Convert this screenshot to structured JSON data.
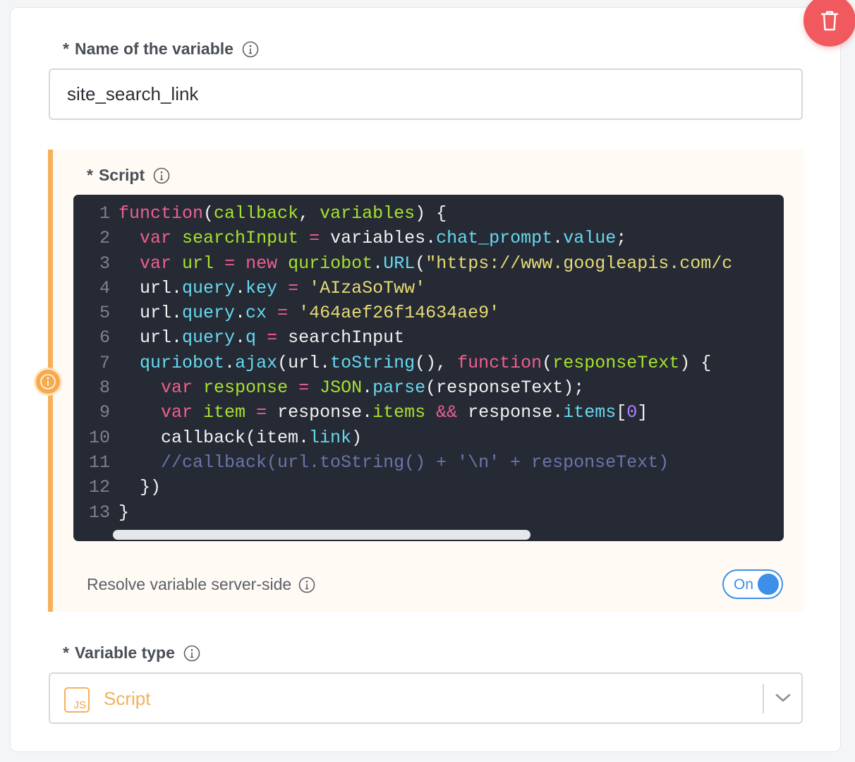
{
  "variable_name": {
    "required_marker": "*",
    "label": "Name of the variable",
    "value": "site_search_link"
  },
  "script": {
    "required_marker": "*",
    "label": "Script",
    "lines": [
      {
        "number": "1",
        "tokens": [
          [
            "kw",
            "function"
          ],
          [
            "p",
            "("
          ],
          [
            "fn",
            "callback"
          ],
          [
            "p",
            ", "
          ],
          [
            "fn",
            "variables"
          ],
          [
            "p",
            ") {"
          ]
        ]
      },
      {
        "number": "2",
        "tokens": [
          [
            "p",
            "  "
          ],
          [
            "kw",
            "var"
          ],
          [
            "p",
            " "
          ],
          [
            "fn",
            "searchInput"
          ],
          [
            "p",
            " "
          ],
          [
            "kw",
            "="
          ],
          [
            "p",
            " variables."
          ],
          [
            "prop",
            "chat_prompt"
          ],
          [
            "p",
            "."
          ],
          [
            "prop",
            "value"
          ],
          [
            "p",
            ";"
          ]
        ]
      },
      {
        "number": "3",
        "tokens": [
          [
            "p",
            "  "
          ],
          [
            "kw",
            "var"
          ],
          [
            "p",
            " "
          ],
          [
            "fn",
            "url"
          ],
          [
            "p",
            " "
          ],
          [
            "kw",
            "="
          ],
          [
            "p",
            " "
          ],
          [
            "kw",
            "new"
          ],
          [
            "p",
            " "
          ],
          [
            "fn",
            "quriobot"
          ],
          [
            "p",
            "."
          ],
          [
            "prop",
            "URL"
          ],
          [
            "p",
            "("
          ],
          [
            "str",
            "\"https://www.googleapis.com/c"
          ]
        ]
      },
      {
        "number": "4",
        "tokens": [
          [
            "p",
            "  url."
          ],
          [
            "prop",
            "query"
          ],
          [
            "p",
            "."
          ],
          [
            "prop",
            "key"
          ],
          [
            "p",
            " "
          ],
          [
            "kw",
            "="
          ],
          [
            "p",
            " "
          ],
          [
            "str",
            "'AIzaSoTww'"
          ]
        ]
      },
      {
        "number": "5",
        "tokens": [
          [
            "p",
            "  url."
          ],
          [
            "prop",
            "query"
          ],
          [
            "p",
            "."
          ],
          [
            "prop",
            "cx"
          ],
          [
            "p",
            " "
          ],
          [
            "kw",
            "="
          ],
          [
            "p",
            " "
          ],
          [
            "str",
            "'464aef26f14634ae9'"
          ]
        ]
      },
      {
        "number": "6",
        "tokens": [
          [
            "p",
            "  url."
          ],
          [
            "prop",
            "query"
          ],
          [
            "p",
            "."
          ],
          [
            "prop",
            "q"
          ],
          [
            "p",
            " "
          ],
          [
            "kw",
            "="
          ],
          [
            "p",
            " searchInput"
          ]
        ]
      },
      {
        "number": "7",
        "tokens": [
          [
            "p",
            "  "
          ],
          [
            "prop",
            "quriobot"
          ],
          [
            "p",
            "."
          ],
          [
            "prop",
            "ajax"
          ],
          [
            "p",
            "(url."
          ],
          [
            "prop",
            "toString"
          ],
          [
            "p",
            "(), "
          ],
          [
            "kw",
            "function"
          ],
          [
            "p",
            "("
          ],
          [
            "fn",
            "responseText"
          ],
          [
            "p",
            ") {"
          ]
        ]
      },
      {
        "number": "8",
        "tokens": [
          [
            "p",
            "    "
          ],
          [
            "kw",
            "var"
          ],
          [
            "p",
            " "
          ],
          [
            "fn",
            "response"
          ],
          [
            "p",
            " "
          ],
          [
            "kw",
            "="
          ],
          [
            "p",
            " "
          ],
          [
            "fn",
            "JSON"
          ],
          [
            "p",
            "."
          ],
          [
            "prop",
            "parse"
          ],
          [
            "p",
            "(responseText);"
          ]
        ]
      },
      {
        "number": "9",
        "tokens": [
          [
            "p",
            "    "
          ],
          [
            "kw",
            "var"
          ],
          [
            "p",
            " "
          ],
          [
            "fn",
            "item"
          ],
          [
            "p",
            " "
          ],
          [
            "kw",
            "="
          ],
          [
            "p",
            " response."
          ],
          [
            "fn",
            "items"
          ],
          [
            "p",
            " "
          ],
          [
            "kw",
            "&&"
          ],
          [
            "p",
            " response."
          ],
          [
            "prop",
            "items"
          ],
          [
            "p",
            "["
          ],
          [
            "num",
            "0"
          ],
          [
            "p",
            "]"
          ]
        ]
      },
      {
        "number": "10",
        "tokens": [
          [
            "p",
            "    callback(item."
          ],
          [
            "prop",
            "link"
          ],
          [
            "p",
            ")"
          ]
        ]
      },
      {
        "number": "11",
        "tokens": [
          [
            "p",
            "    "
          ],
          [
            "cmt",
            "//callback(url.toString() + '\\n' + responseText)"
          ]
        ]
      },
      {
        "number": "12",
        "tokens": [
          [
            "p",
            "  })"
          ]
        ]
      },
      {
        "number": "13",
        "tokens": [
          [
            "p",
            "}"
          ]
        ]
      }
    ]
  },
  "resolve_server_side": {
    "label": "Resolve variable server-side",
    "toggle_text": "On",
    "enabled": true
  },
  "variable_type": {
    "required_marker": "*",
    "label": "Variable type",
    "badge": "JS",
    "value": "Script"
  },
  "icons": {
    "delete": "trash-icon",
    "info": "info-icon",
    "chevron": "chevron-down-icon"
  },
  "colors": {
    "accent": "#f7b05a",
    "delete": "#f0595d",
    "toggle": "#3d8fe8",
    "editor_bg": "#262a35"
  }
}
